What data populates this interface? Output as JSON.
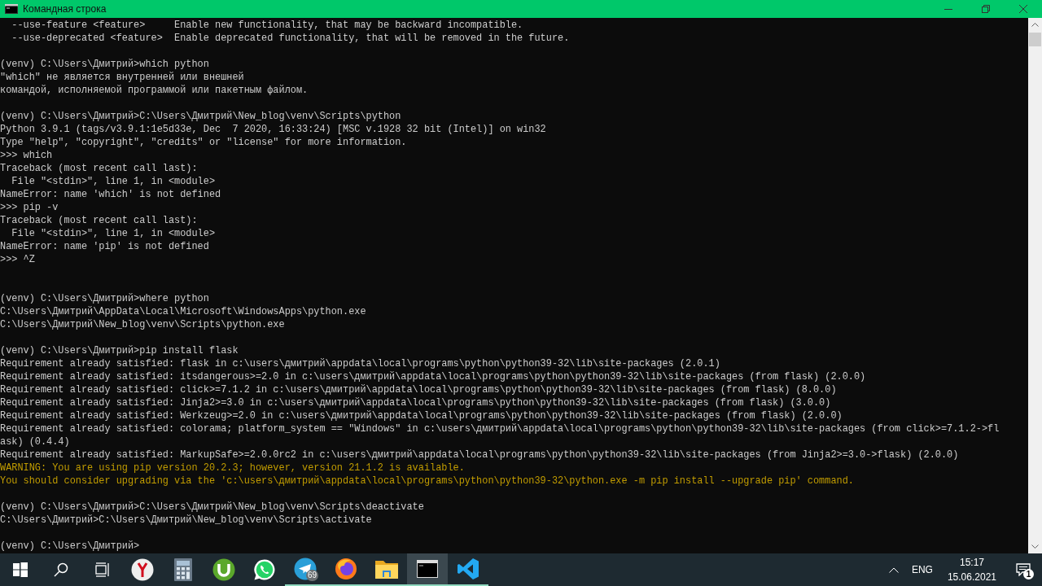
{
  "window": {
    "title": "Командная строка"
  },
  "console": {
    "lines": [
      {
        "kind": "output",
        "text": "  --use-feature <feature>     Enable new functionality, that may be backward incompatible."
      },
      {
        "kind": "output",
        "text": "  --use-deprecated <feature>  Enable deprecated functionality, that will be removed in the future."
      },
      {
        "kind": "blank"
      },
      {
        "kind": "output",
        "text": "(venv) C:\\Users\\Дмитрий>which python"
      },
      {
        "kind": "output",
        "text": "\"which\" не является внутренней или внешней"
      },
      {
        "kind": "output",
        "text": "командой, исполняемой программой или пакетным файлом."
      },
      {
        "kind": "blank"
      },
      {
        "kind": "output",
        "text": "(venv) C:\\Users\\Дмитрий>C:\\Users\\Дмитрий\\New_blog\\venv\\Scripts\\python"
      },
      {
        "kind": "output",
        "text": "Python 3.9.1 (tags/v3.9.1:1e5d33e, Dec  7 2020, 16:33:24) [MSC v.1928 32 bit (Intel)] on win32"
      },
      {
        "kind": "output",
        "text": "Type \"help\", \"copyright\", \"credits\" or \"license\" for more information."
      },
      {
        "kind": "output",
        "text": ">>> which"
      },
      {
        "kind": "output",
        "text": "Traceback (most recent call last):"
      },
      {
        "kind": "output",
        "text": "  File \"<stdin>\", line 1, in <module>"
      },
      {
        "kind": "output",
        "text": "NameError: name 'which' is not defined"
      },
      {
        "kind": "output",
        "text": ">>> pip -v"
      },
      {
        "kind": "output",
        "text": "Traceback (most recent call last):"
      },
      {
        "kind": "output",
        "text": "  File \"<stdin>\", line 1, in <module>"
      },
      {
        "kind": "output",
        "text": "NameError: name 'pip' is not defined"
      },
      {
        "kind": "output",
        "text": ">>> ^Z"
      },
      {
        "kind": "blank"
      },
      {
        "kind": "blank"
      },
      {
        "kind": "output",
        "text": "(venv) C:\\Users\\Дмитрий>where python"
      },
      {
        "kind": "output",
        "text": "C:\\Users\\Дмитрий\\AppData\\Local\\Microsoft\\WindowsApps\\python.exe"
      },
      {
        "kind": "output",
        "text": "C:\\Users\\Дмитрий\\New_blog\\venv\\Scripts\\python.exe"
      },
      {
        "kind": "blank"
      },
      {
        "kind": "output",
        "text": "(venv) C:\\Users\\Дмитрий>pip install flask"
      },
      {
        "kind": "output",
        "text": "Requirement already satisfied: flask in c:\\users\\дмитрий\\appdata\\local\\programs\\python\\python39-32\\lib\\site-packages (2.0.1)"
      },
      {
        "kind": "output",
        "text": "Requirement already satisfied: itsdangerous>=2.0 in c:\\users\\дмитрий\\appdata\\local\\programs\\python\\python39-32\\lib\\site-packages (from flask) (2.0.0)"
      },
      {
        "kind": "output",
        "text": "Requirement already satisfied: click>=7.1.2 in c:\\users\\дмитрий\\appdata\\local\\programs\\python\\python39-32\\lib\\site-packages (from flask) (8.0.0)"
      },
      {
        "kind": "output",
        "text": "Requirement already satisfied: Jinja2>=3.0 in c:\\users\\дмитрий\\appdata\\local\\programs\\python\\python39-32\\lib\\site-packages (from flask) (3.0.0)"
      },
      {
        "kind": "output",
        "text": "Requirement already satisfied: Werkzeug>=2.0 in c:\\users\\дмитрий\\appdata\\local\\programs\\python\\python39-32\\lib\\site-packages (from flask) (2.0.0)"
      },
      {
        "kind": "output",
        "text": "Requirement already satisfied: colorama; platform_system == \"Windows\" in c:\\users\\дмитрий\\appdata\\local\\programs\\python\\python39-32\\lib\\site-packages (from click>=7.1.2->fl"
      },
      {
        "kind": "output",
        "text": "ask) (0.4.4)"
      },
      {
        "kind": "output",
        "text": "Requirement already satisfied: MarkupSafe>=2.0.0rc2 in c:\\users\\дмитрий\\appdata\\local\\programs\\python\\python39-32\\lib\\site-packages (from Jinja2>=3.0->flask) (2.0.0)"
      },
      {
        "kind": "warning",
        "text": "WARNING: You are using pip version 20.2.3; however, version 21.1.2 is available."
      },
      {
        "kind": "warning",
        "text": "You should consider upgrading via the 'c:\\users\\дмитрий\\appdata\\local\\programs\\python\\python39-32\\python.exe -m pip install --upgrade pip' command."
      },
      {
        "kind": "blank"
      },
      {
        "kind": "output",
        "text": "(venv) C:\\Users\\Дмитрий>C:\\Users\\Дмитрий\\New_blog\\venv\\Scripts\\deactivate"
      },
      {
        "kind": "output",
        "text": "C:\\Users\\Дмитрий>C:\\Users\\Дмитрий\\New_blog\\venv\\Scripts\\activate"
      },
      {
        "kind": "blank"
      },
      {
        "kind": "output",
        "text": "(venv) C:\\Users\\Дмитрий>"
      }
    ]
  },
  "taskbar": {
    "apps": [
      {
        "kind": "start",
        "running": false,
        "selected": false
      },
      {
        "kind": "search",
        "running": false,
        "selected": false
      },
      {
        "kind": "taskview",
        "running": false,
        "selected": false
      },
      {
        "kind": "yandex",
        "running": false,
        "selected": false
      },
      {
        "kind": "calculator",
        "running": false,
        "selected": false
      },
      {
        "kind": "utorrent",
        "running": false,
        "selected": false
      },
      {
        "kind": "whatsapp",
        "running": false,
        "selected": false
      },
      {
        "kind": "telegram",
        "running": true,
        "selected": false,
        "badge": "69"
      },
      {
        "kind": "firefox",
        "running": true,
        "selected": false
      },
      {
        "kind": "explorer",
        "running": true,
        "selected": false
      },
      {
        "kind": "terminal",
        "running": true,
        "selected": true
      },
      {
        "kind": "vscode",
        "running": true,
        "selected": false
      }
    ],
    "tray": {
      "language": "ENG",
      "time": "15:17",
      "date": "15.06.2021",
      "notifications": "1"
    }
  }
}
